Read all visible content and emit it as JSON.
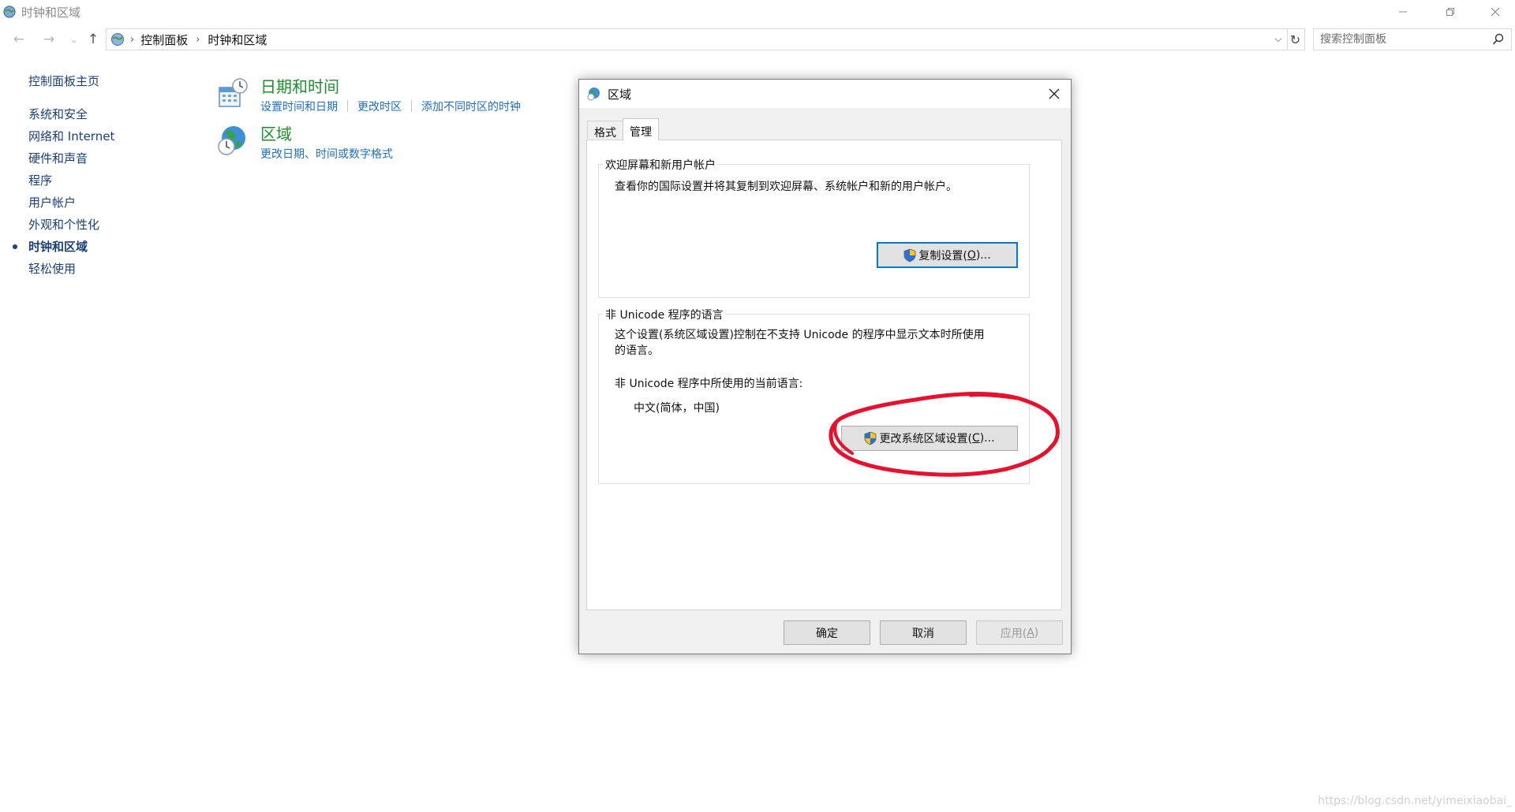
{
  "window": {
    "title": "时钟和区域"
  },
  "nav": {
    "breadcrumb": [
      "控制面板",
      "时钟和区域"
    ],
    "search_placeholder": "搜索控制面板"
  },
  "sidebar": {
    "home": "控制面板主页",
    "items": [
      {
        "label": "系统和安全",
        "active": false
      },
      {
        "label": "网络和 Internet",
        "active": false
      },
      {
        "label": "硬件和声音",
        "active": false
      },
      {
        "label": "程序",
        "active": false
      },
      {
        "label": "用户帐户",
        "active": false
      },
      {
        "label": "外观和个性化",
        "active": false
      },
      {
        "label": "时钟和区域",
        "active": true
      },
      {
        "label": "轻松使用",
        "active": false
      }
    ]
  },
  "categories": {
    "datetime": {
      "heading": "日期和时间",
      "links": [
        "设置时间和日期",
        "更改时区",
        "添加不同时区的时钟"
      ]
    },
    "region": {
      "heading": "区域",
      "links": [
        "更改日期、时间或数字格式"
      ]
    }
  },
  "dialog": {
    "title": "区域",
    "tabs": [
      {
        "label": "格式",
        "selected": false
      },
      {
        "label": "管理",
        "selected": true
      }
    ],
    "welcome_group": {
      "legend": "欢迎屏幕和新用户帐户",
      "description": "查看你的国际设置并将其复制到欢迎屏幕、系统帐户和新的用户帐户。",
      "button_text": "复制设置(",
      "button_key": "O",
      "button_tail": ")..."
    },
    "unicode_group": {
      "legend": "非 Unicode 程序的语言",
      "description_line1": "这个设置(系统区域设置)控制在不支持 Unicode 的程序中显示文本时所使用",
      "description_line2": "的语言。",
      "current_label": "非 Unicode 程序中所使用的当前语言:",
      "current_value": "中文(简体，中国)",
      "button_text": "更改系统区域设置(",
      "button_key": "C",
      "button_tail": ")..."
    },
    "buttons": {
      "ok": "确定",
      "cancel": "取消",
      "apply_text": "应用(",
      "apply_key": "A",
      "apply_tail": ")"
    }
  },
  "watermark": "https://blog.csdn.net/yimeixiaobai_",
  "colors": {
    "link": "#1f6fc5",
    "category_heading": "#1e8f2e",
    "annotation": "#e8102c",
    "focus": "#0078d7"
  }
}
